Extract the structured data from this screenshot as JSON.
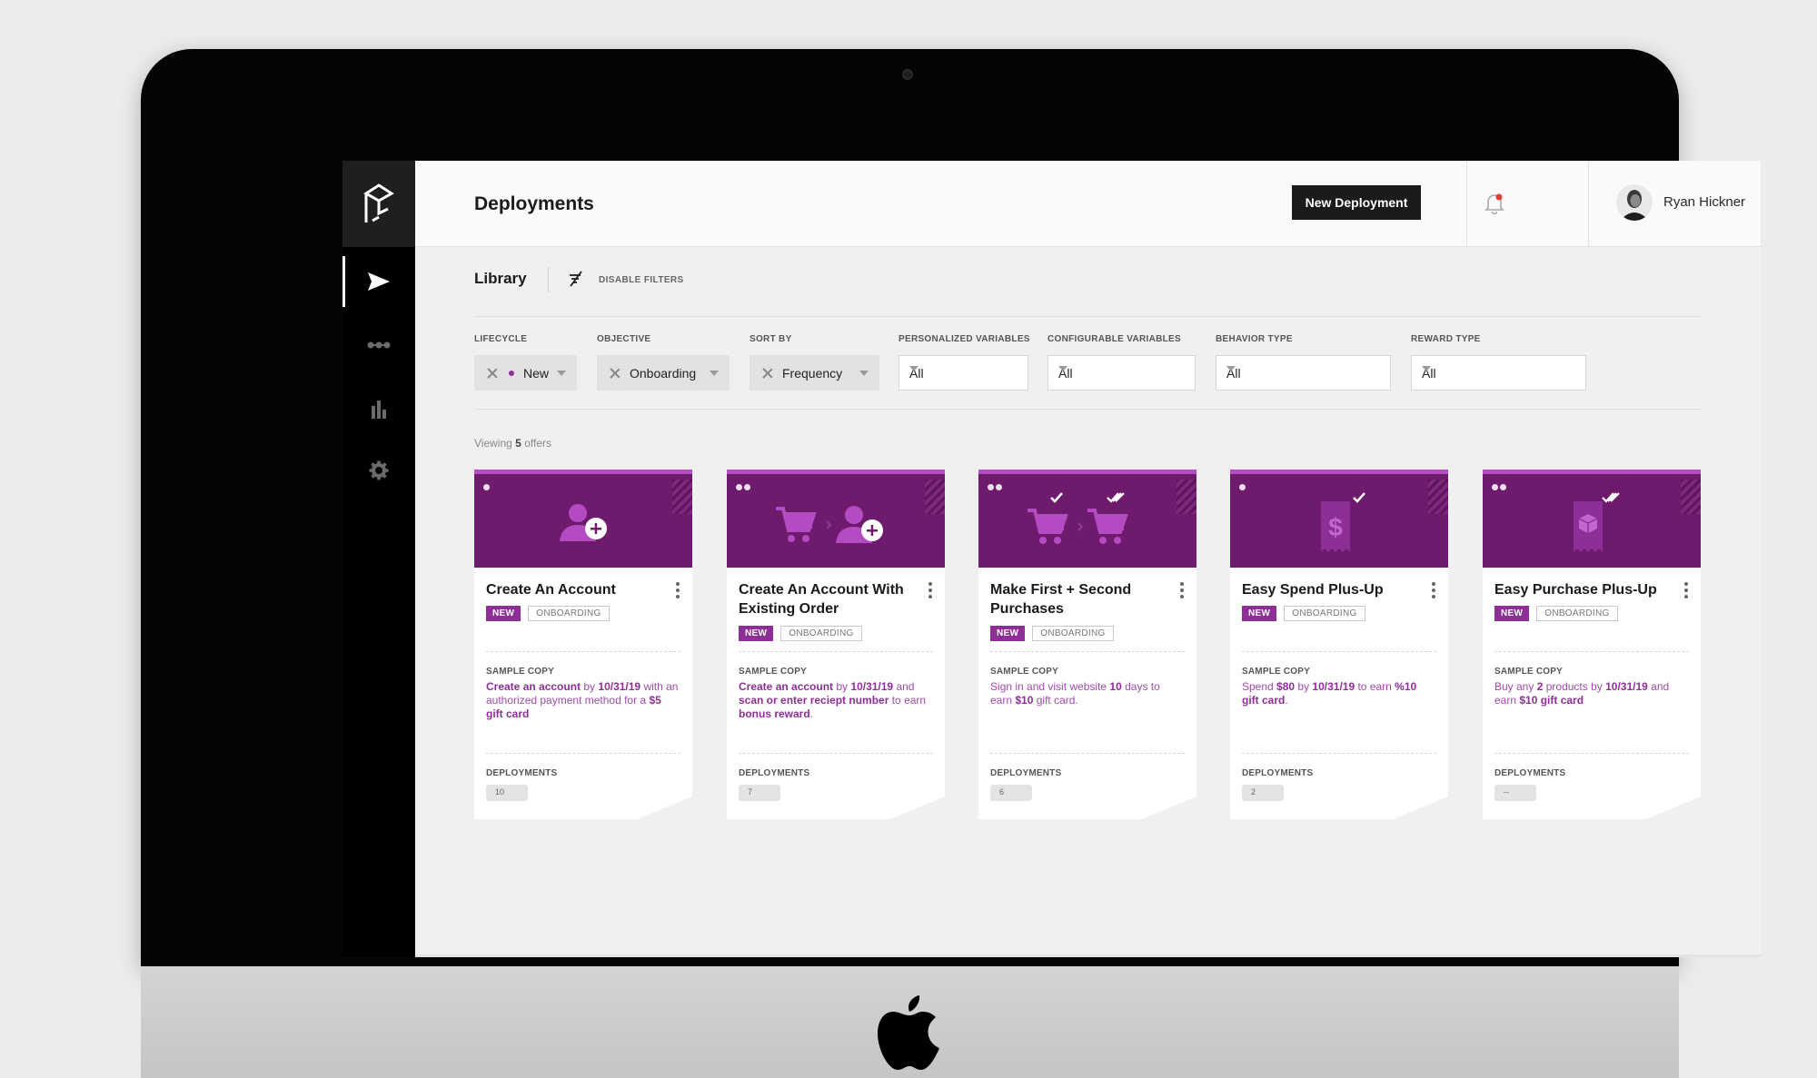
{
  "header": {
    "title": "Deployments",
    "new_button": "New Deployment",
    "user_name": "Ryan Hickner"
  },
  "sidebar": {
    "items": [
      {
        "icon": "send-icon",
        "active": true
      },
      {
        "icon": "journey-icon",
        "active": false
      },
      {
        "icon": "bar-chart-icon",
        "active": false
      },
      {
        "icon": "gear-icon",
        "active": false
      }
    ]
  },
  "library": {
    "label": "Library",
    "disable_filters": "DISABLE FILTERS"
  },
  "filters": {
    "lifecycle": {
      "label": "LIFECYCLE",
      "value": "New"
    },
    "objective": {
      "label": "OBJECTIVE",
      "value": "Onboarding"
    },
    "sort_by": {
      "label": "SORT BY",
      "value": "Frequency"
    },
    "personalized": {
      "label": "PERSONALIZED VARIABLES",
      "value": "All"
    },
    "configurable": {
      "label": "CONFIGURABLE VARIABLES",
      "value": "All"
    },
    "behavior": {
      "label": "BEHAVIOR TYPE",
      "value": "All"
    },
    "reward": {
      "label": "REWARD TYPE",
      "value": "All"
    }
  },
  "viewing": {
    "prefix": "Viewing",
    "count": "5",
    "suffix": "offers"
  },
  "cards": [
    {
      "title": "Create An Account",
      "tag_new": "NEW",
      "tag_cat": "ONBOARDING",
      "copy_label": "SAMPLE COPY",
      "deploy_label": "DEPLOYMENTS",
      "deployments": "10"
    },
    {
      "title": "Create An Account With Existing Order",
      "tag_new": "NEW",
      "tag_cat": "ONBOARDING",
      "copy_label": "SAMPLE COPY",
      "deploy_label": "DEPLOYMENTS",
      "deployments": "7"
    },
    {
      "title": "Make First + Second Purchases",
      "tag_new": "NEW",
      "tag_cat": "ONBOARDING",
      "copy_label": "SAMPLE COPY",
      "deploy_label": "DEPLOYMENTS",
      "deployments": "6"
    },
    {
      "title": "Easy Spend Plus-Up",
      "tag_new": "NEW",
      "tag_cat": "ONBOARDING",
      "copy_label": "SAMPLE COPY",
      "deploy_label": "DEPLOYMENTS",
      "deployments": "2"
    },
    {
      "title": "Easy Purchase Plus-Up",
      "tag_new": "NEW",
      "tag_cat": "ONBOARDING",
      "copy_label": "SAMPLE COPY",
      "deploy_label": "DEPLOYMENTS",
      "deployments": "--"
    }
  ],
  "copy": {
    "c1": [
      "Create an account",
      " by ",
      "10/31/19",
      " with an authorized payment method for a ",
      "$5 gift card"
    ],
    "c2": [
      "Create an account",
      " by ",
      "10/31/19",
      " and ",
      "scan or enter reciept number",
      " to earn ",
      "bonus reward",
      "."
    ],
    "c3": [
      "Sign in and visit website ",
      "10",
      " days to earn ",
      "$10",
      " gift card."
    ],
    "c4": [
      "Spend ",
      "$80",
      " by ",
      "10/31/19",
      " to earn ",
      "%10 gift card",
      "."
    ],
    "c5": [
      "Buy any ",
      "2",
      " products by ",
      "10/31/19",
      " and earn ",
      "$10 gift card"
    ]
  },
  "colors": {
    "accent": "#8e2f98",
    "hero": "#6e1b6d",
    "sidebar": "#000000"
  }
}
